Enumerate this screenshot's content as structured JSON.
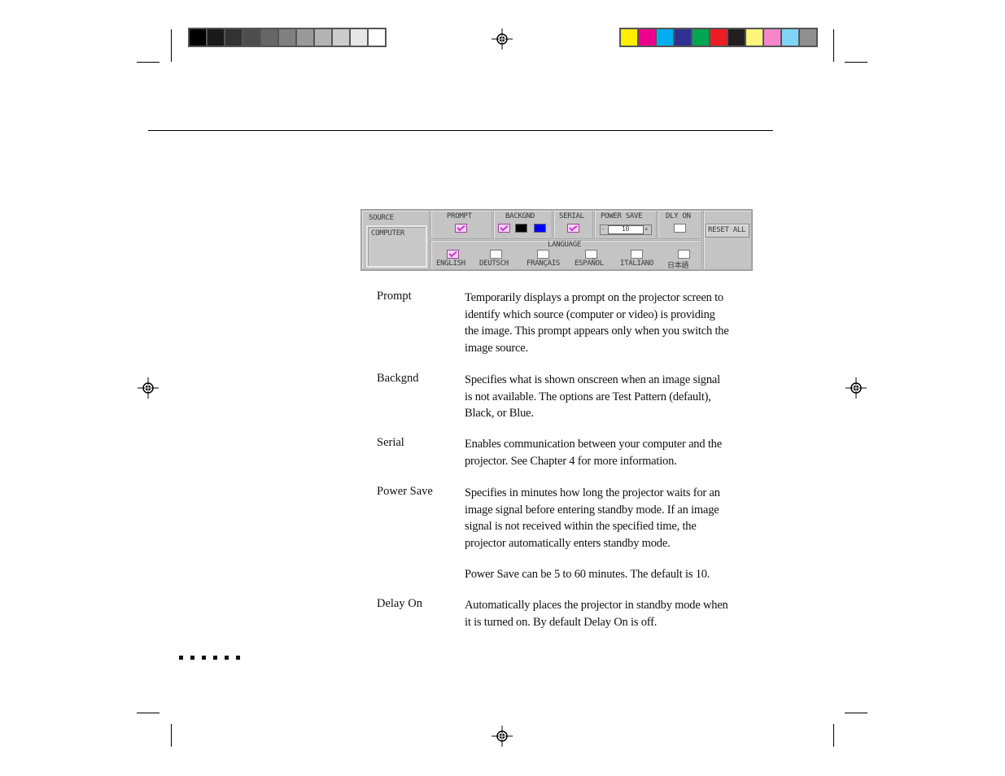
{
  "print_marks": {
    "grayscale_bar": [
      "#000000",
      "#1a1a1a",
      "#333333",
      "#4d4d4d",
      "#666666",
      "#808080",
      "#999999",
      "#b3b3b3",
      "#cccccc",
      "#e6e6e6",
      "#ffffff"
    ],
    "color_bar": [
      "#ffee00",
      "#ec008c",
      "#00aeef",
      "#2e3192",
      "#00a651",
      "#ed1c24",
      "#231f20",
      "#fff57d",
      "#f786c8",
      "#7fd4f8",
      "#8f8f8f"
    ],
    "page_marker_count": 6
  },
  "panel": {
    "source": {
      "label": "SOURCE",
      "value": "COMPUTER"
    },
    "prompt": {
      "label": "PROMPT",
      "checked": true
    },
    "backgnd": {
      "label": "BACKGND",
      "options": [
        {
          "name": "test-pattern",
          "selected": true,
          "color": "#f4d6f4"
        },
        {
          "name": "black",
          "selected": false,
          "color": "#000000"
        },
        {
          "name": "blue",
          "selected": false,
          "color": "#0000ff"
        }
      ]
    },
    "serial": {
      "label": "SERIAL",
      "checked": true
    },
    "power_save": {
      "label": "POWER SAVE",
      "value": "10",
      "minus": "-",
      "plus": "+"
    },
    "dly_on": {
      "label": "DLY ON",
      "checked": false
    },
    "reset_all": {
      "label": "RESET ALL"
    },
    "language": {
      "label": "LANGUAGE",
      "options": [
        {
          "label": "ENGLISH",
          "checked": true
        },
        {
          "label": "DEUTSCH",
          "checked": false
        },
        {
          "label": "FRANÇAIS",
          "checked": false
        },
        {
          "label": "ESPAÑOL",
          "checked": false
        },
        {
          "label": "ITALIANO",
          "checked": false
        },
        {
          "label": "日本語",
          "checked": false
        }
      ]
    }
  },
  "definitions": [
    {
      "term": "Prompt",
      "lines": [
        "Temporarily displays a prompt on the projector screen to",
        "identify which source (computer or video) is providing",
        "the image. This prompt appears only when you switch the",
        "image source."
      ]
    },
    {
      "term": "Backgnd",
      "lines": [
        "Specifies what is shown onscreen when an image signal",
        "is not available. The options are Test Pattern (default),",
        "Black, or Blue."
      ]
    },
    {
      "term": "Serial",
      "lines": [
        "Enables communication between your computer and the",
        "projector. See Chapter 4 for more information."
      ]
    },
    {
      "term": "Power Save",
      "lines": [
        "Specifies in minutes how long the projector waits for an",
        "image signal before entering standby mode. If an image",
        "signal is not received within the specified time, the",
        "projector automatically enters standby mode."
      ]
    },
    {
      "term": "",
      "lines": [
        "Power Save can be 5 to 60 minutes. The default is 10."
      ]
    },
    {
      "term": "Delay On",
      "lines": [
        "Automatically places the projector in standby mode when",
        "it is turned on. By default Delay On is off."
      ]
    }
  ]
}
